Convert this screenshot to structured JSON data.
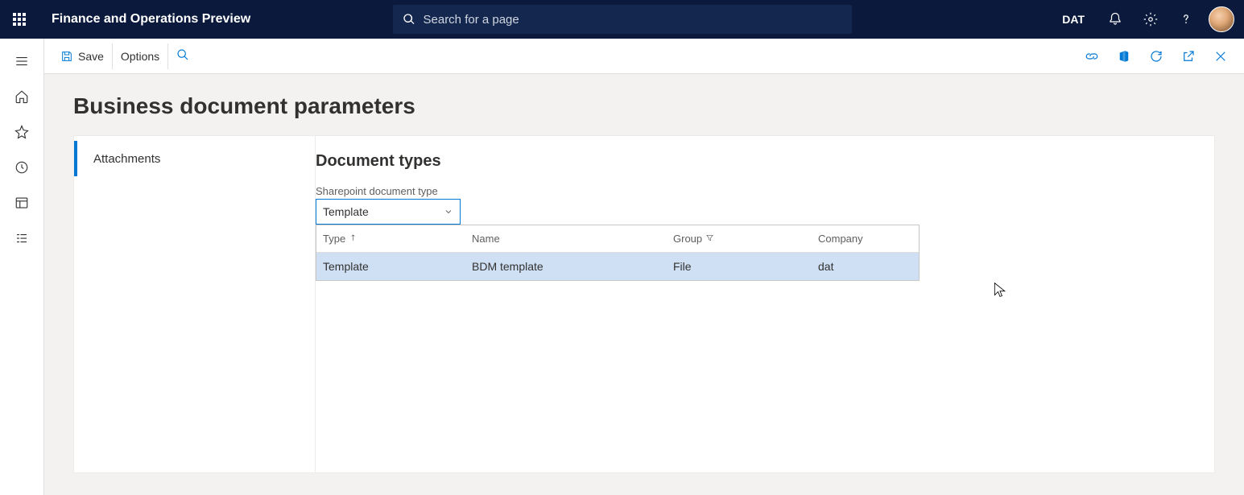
{
  "header": {
    "app_title": "Finance and Operations Preview",
    "search_placeholder": "Search for a page",
    "entity": "DAT"
  },
  "actionbar": {
    "save": "Save",
    "options": "Options"
  },
  "page": {
    "title": "Business document parameters"
  },
  "tabs": {
    "attachments": "Attachments"
  },
  "section": {
    "title": "Document types",
    "field_label": "Sharepoint document type",
    "field_value": "Template"
  },
  "lookup": {
    "headers": {
      "type": "Type",
      "name": "Name",
      "group": "Group",
      "company": "Company"
    },
    "row": {
      "type": "Template",
      "name": "BDM template",
      "group": "File",
      "company": "dat"
    }
  }
}
